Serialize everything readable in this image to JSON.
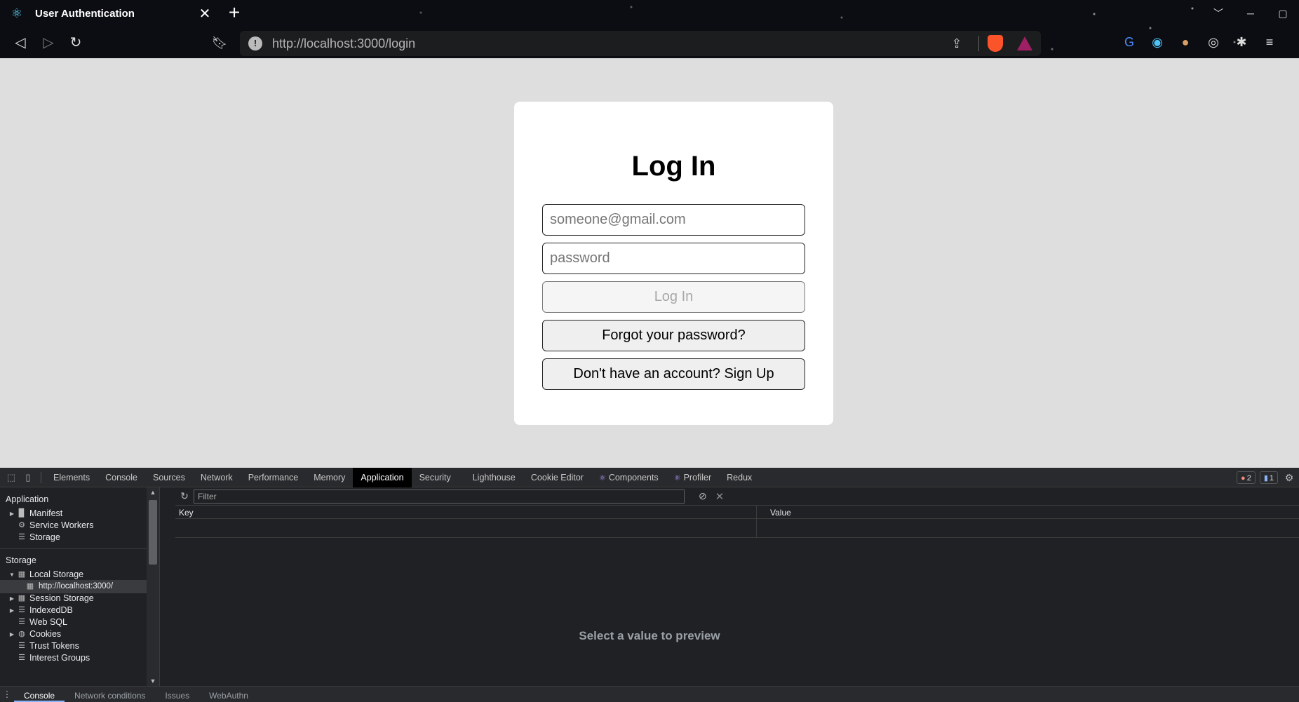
{
  "browser": {
    "tab_title": "User Authentication",
    "tab_close": "✕",
    "new_tab": "+",
    "url": "http://localhost:3000/login",
    "window_controls": [
      "﹀",
      "─",
      "▢"
    ],
    "icons": {
      "tab": "react-icon",
      "back": "back-icon",
      "forward": "forward-icon",
      "reload": "reload-icon",
      "bookmark": "bookmark-icon",
      "site_info": "info-icon",
      "share": "share-icon",
      "brave": "brave-shields-icon",
      "rewards": "brave-rewards-icon"
    },
    "extensions": [
      "google-translate-icon",
      "camera-icon",
      "cookie-icon",
      "target-icon",
      "puzzle-icon",
      "playlist-icon"
    ]
  },
  "login": {
    "title": "Log In",
    "email_placeholder": "someone@gmail.com",
    "password_placeholder": "password",
    "login_label": "Log In",
    "forgot_label": "Forgot your password?",
    "signup_label": "Don't have an account? Sign Up",
    "colors": {
      "page_bg": "#dedede",
      "card_bg": "#ffffff"
    }
  },
  "devtools": {
    "tabs": [
      "Elements",
      "Console",
      "Sources",
      "Network",
      "Performance",
      "Memory",
      "Application",
      "Security",
      "Lighthouse",
      "Cookie Editor",
      "Components",
      "Profiler",
      "Redux"
    ],
    "active_tab": "Application",
    "error_count": "2",
    "message_count": "1",
    "sidebar": {
      "application_header": "Application",
      "manifest": "Manifest",
      "service_workers": "Service Workers",
      "storage_item": "Storage",
      "storage_header": "Storage",
      "local_storage": "Local Storage",
      "local_storage_origin": "http://localhost:3000/",
      "session_storage": "Session Storage",
      "indexeddb": "IndexedDB",
      "web_sql": "Web SQL",
      "cookies": "Cookies",
      "trust_tokens": "Trust Tokens",
      "interest_groups": "Interest Groups"
    },
    "filter_placeholder": "Filter",
    "table": {
      "key_header": "Key",
      "value_header": "Value"
    },
    "preview_message": "Select a value to preview",
    "drawer_tabs": [
      "Console",
      "Network conditions",
      "Issues",
      "WebAuthn"
    ],
    "drawer_active": "Console"
  }
}
